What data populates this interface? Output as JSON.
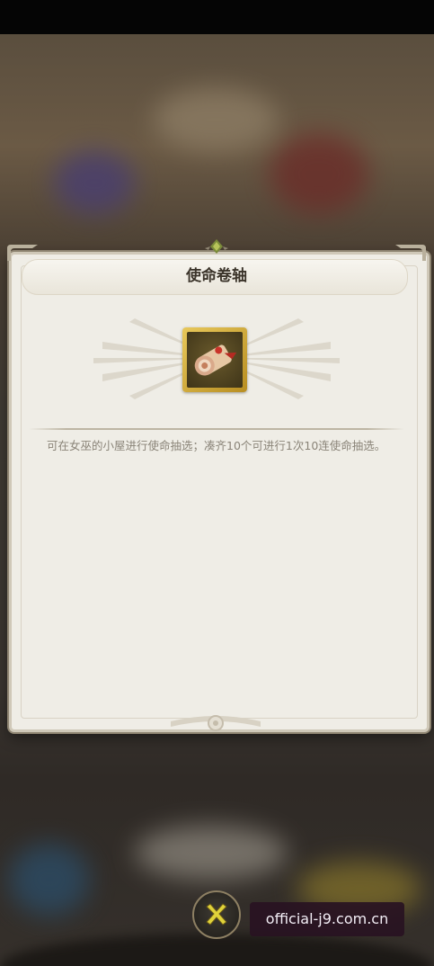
{
  "dialog": {
    "title": "使命卷轴",
    "item_icon": "scroll-icon",
    "description": "可在女巫的小屋进行使命抽选；凑齐10个可进行1次10连使命抽选。"
  },
  "close_button": {
    "icon": "close-x-icon"
  },
  "watermark": {
    "text": "official-j9.com.cn"
  },
  "colors": {
    "panel_bg": "#efede6",
    "title_text": "#3b342a",
    "description_text": "#8a8478",
    "item_frame_gold": "#d4b040",
    "close_x": "#e0d23a",
    "watermark_bg": "#281222"
  }
}
